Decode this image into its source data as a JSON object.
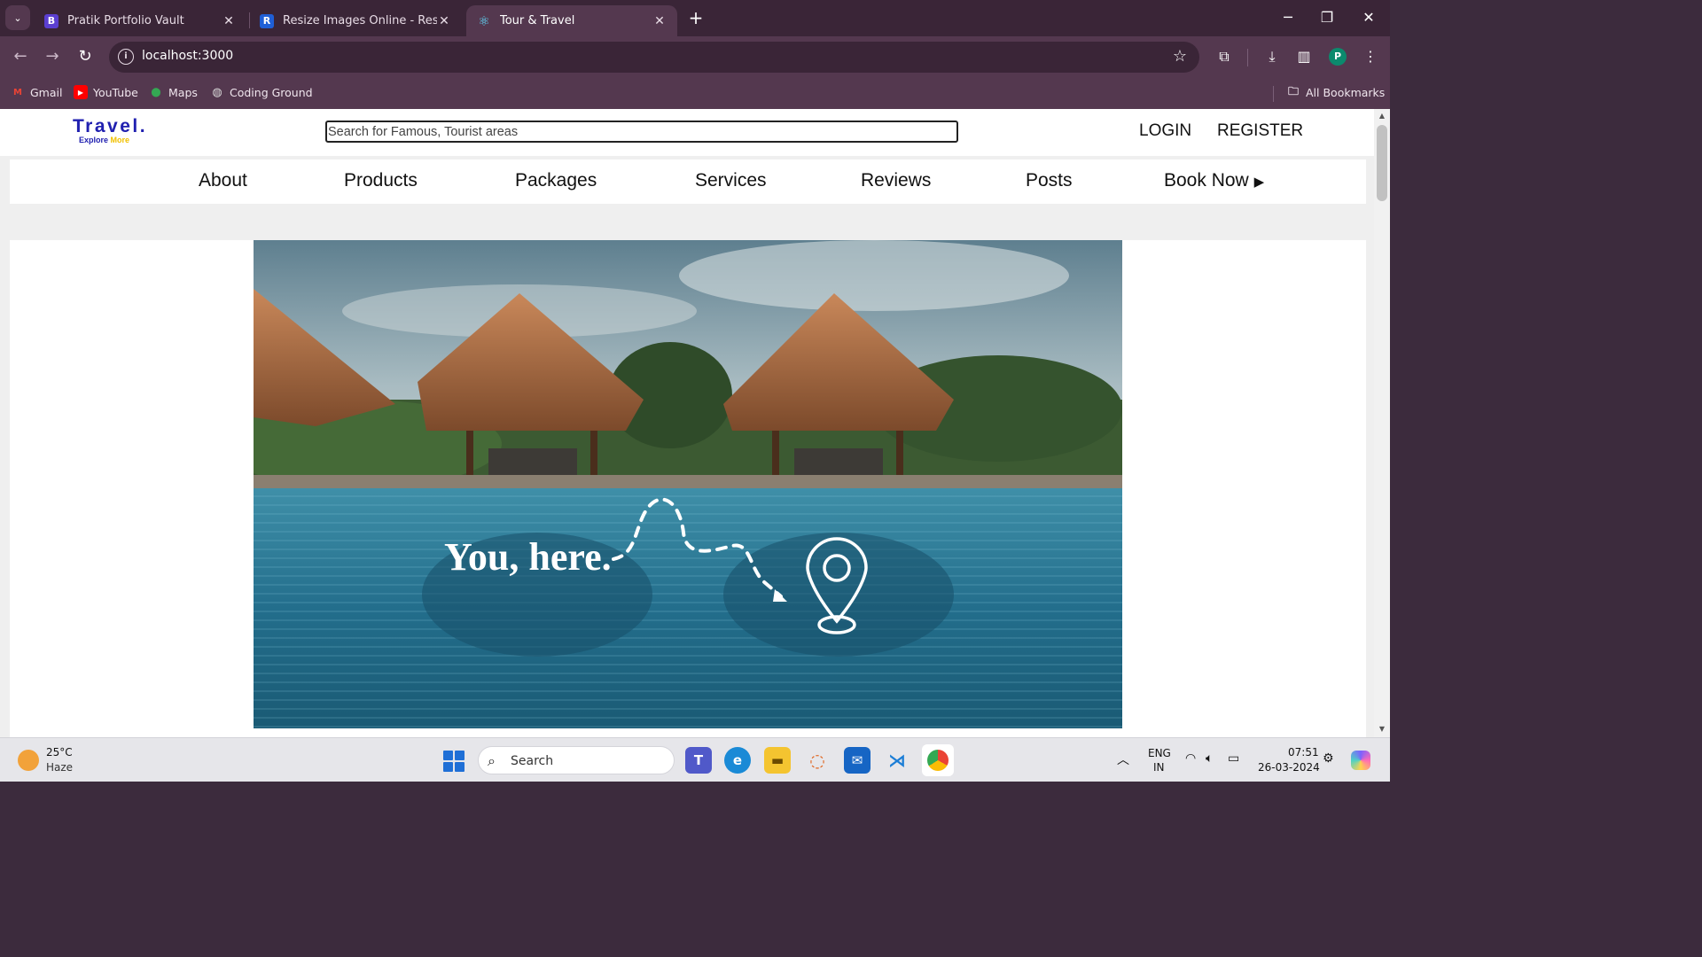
{
  "browser": {
    "tabs": [
      {
        "title": "Pratik Portfolio Vault",
        "icon": "bootstrap-icon",
        "active": false
      },
      {
        "title": "Resize Images Online - Resize JPG",
        "icon": "resize-image-icon",
        "active": false
      },
      {
        "title": "Tour & Travel",
        "icon": "react-icon",
        "active": true
      }
    ],
    "url": "localhost:3000",
    "profile_initial": "P",
    "bookmarks": [
      {
        "label": "Gmail",
        "icon": "gmail-icon"
      },
      {
        "label": "YouTube",
        "icon": "youtube-icon"
      },
      {
        "label": "Maps",
        "icon": "maps-icon"
      },
      {
        "label": "Coding Ground",
        "icon": "globe-icon"
      }
    ],
    "all_bookmarks": "All Bookmarks"
  },
  "site": {
    "logo": {
      "title": "Travel.",
      "sub_a": "Explore",
      "sub_b": "More"
    },
    "search_placeholder": "Search for Famous, Tourist areas",
    "login": "LOGIN",
    "register": "REGISTER",
    "nav": [
      "About",
      "Products",
      "Packages",
      "Services",
      "Reviews",
      "Posts",
      "Book Now"
    ],
    "hero_tagline": "You, here."
  },
  "taskbar": {
    "temperature": "25°C",
    "weather": "Haze",
    "search_label": "Search",
    "language": "ENG",
    "region": "IN",
    "time": "07:51",
    "date": "26-03-2024"
  },
  "colors": {
    "logo_blue": "#2020b0",
    "logo_yellow": "#f0c000",
    "chrome_frame": "#3a2537",
    "chrome_toolbar": "#54384f"
  }
}
